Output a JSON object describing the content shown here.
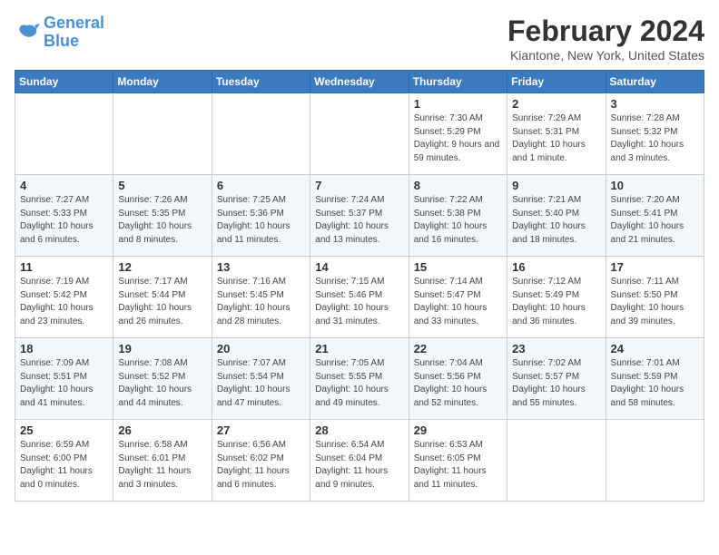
{
  "header": {
    "logo_general": "General",
    "logo_blue": "Blue",
    "month_title": "February 2024",
    "location": "Kiantone, New York, United States"
  },
  "days_of_week": [
    "Sunday",
    "Monday",
    "Tuesday",
    "Wednesday",
    "Thursday",
    "Friday",
    "Saturday"
  ],
  "weeks": [
    [
      {
        "day": "",
        "info": ""
      },
      {
        "day": "",
        "info": ""
      },
      {
        "day": "",
        "info": ""
      },
      {
        "day": "",
        "info": ""
      },
      {
        "day": "1",
        "info": "Sunrise: 7:30 AM\nSunset: 5:29 PM\nDaylight: 9 hours and 59 minutes."
      },
      {
        "day": "2",
        "info": "Sunrise: 7:29 AM\nSunset: 5:31 PM\nDaylight: 10 hours and 1 minute."
      },
      {
        "day": "3",
        "info": "Sunrise: 7:28 AM\nSunset: 5:32 PM\nDaylight: 10 hours and 3 minutes."
      }
    ],
    [
      {
        "day": "4",
        "info": "Sunrise: 7:27 AM\nSunset: 5:33 PM\nDaylight: 10 hours and 6 minutes."
      },
      {
        "day": "5",
        "info": "Sunrise: 7:26 AM\nSunset: 5:35 PM\nDaylight: 10 hours and 8 minutes."
      },
      {
        "day": "6",
        "info": "Sunrise: 7:25 AM\nSunset: 5:36 PM\nDaylight: 10 hours and 11 minutes."
      },
      {
        "day": "7",
        "info": "Sunrise: 7:24 AM\nSunset: 5:37 PM\nDaylight: 10 hours and 13 minutes."
      },
      {
        "day": "8",
        "info": "Sunrise: 7:22 AM\nSunset: 5:38 PM\nDaylight: 10 hours and 16 minutes."
      },
      {
        "day": "9",
        "info": "Sunrise: 7:21 AM\nSunset: 5:40 PM\nDaylight: 10 hours and 18 minutes."
      },
      {
        "day": "10",
        "info": "Sunrise: 7:20 AM\nSunset: 5:41 PM\nDaylight: 10 hours and 21 minutes."
      }
    ],
    [
      {
        "day": "11",
        "info": "Sunrise: 7:19 AM\nSunset: 5:42 PM\nDaylight: 10 hours and 23 minutes."
      },
      {
        "day": "12",
        "info": "Sunrise: 7:17 AM\nSunset: 5:44 PM\nDaylight: 10 hours and 26 minutes."
      },
      {
        "day": "13",
        "info": "Sunrise: 7:16 AM\nSunset: 5:45 PM\nDaylight: 10 hours and 28 minutes."
      },
      {
        "day": "14",
        "info": "Sunrise: 7:15 AM\nSunset: 5:46 PM\nDaylight: 10 hours and 31 minutes."
      },
      {
        "day": "15",
        "info": "Sunrise: 7:14 AM\nSunset: 5:47 PM\nDaylight: 10 hours and 33 minutes."
      },
      {
        "day": "16",
        "info": "Sunrise: 7:12 AM\nSunset: 5:49 PM\nDaylight: 10 hours and 36 minutes."
      },
      {
        "day": "17",
        "info": "Sunrise: 7:11 AM\nSunset: 5:50 PM\nDaylight: 10 hours and 39 minutes."
      }
    ],
    [
      {
        "day": "18",
        "info": "Sunrise: 7:09 AM\nSunset: 5:51 PM\nDaylight: 10 hours and 41 minutes."
      },
      {
        "day": "19",
        "info": "Sunrise: 7:08 AM\nSunset: 5:52 PM\nDaylight: 10 hours and 44 minutes."
      },
      {
        "day": "20",
        "info": "Sunrise: 7:07 AM\nSunset: 5:54 PM\nDaylight: 10 hours and 47 minutes."
      },
      {
        "day": "21",
        "info": "Sunrise: 7:05 AM\nSunset: 5:55 PM\nDaylight: 10 hours and 49 minutes."
      },
      {
        "day": "22",
        "info": "Sunrise: 7:04 AM\nSunset: 5:56 PM\nDaylight: 10 hours and 52 minutes."
      },
      {
        "day": "23",
        "info": "Sunrise: 7:02 AM\nSunset: 5:57 PM\nDaylight: 10 hours and 55 minutes."
      },
      {
        "day": "24",
        "info": "Sunrise: 7:01 AM\nSunset: 5:59 PM\nDaylight: 10 hours and 58 minutes."
      }
    ],
    [
      {
        "day": "25",
        "info": "Sunrise: 6:59 AM\nSunset: 6:00 PM\nDaylight: 11 hours and 0 minutes."
      },
      {
        "day": "26",
        "info": "Sunrise: 6:58 AM\nSunset: 6:01 PM\nDaylight: 11 hours and 3 minutes."
      },
      {
        "day": "27",
        "info": "Sunrise: 6:56 AM\nSunset: 6:02 PM\nDaylight: 11 hours and 6 minutes."
      },
      {
        "day": "28",
        "info": "Sunrise: 6:54 AM\nSunset: 6:04 PM\nDaylight: 11 hours and 9 minutes."
      },
      {
        "day": "29",
        "info": "Sunrise: 6:53 AM\nSunset: 6:05 PM\nDaylight: 11 hours and 11 minutes."
      },
      {
        "day": "",
        "info": ""
      },
      {
        "day": "",
        "info": ""
      }
    ]
  ]
}
